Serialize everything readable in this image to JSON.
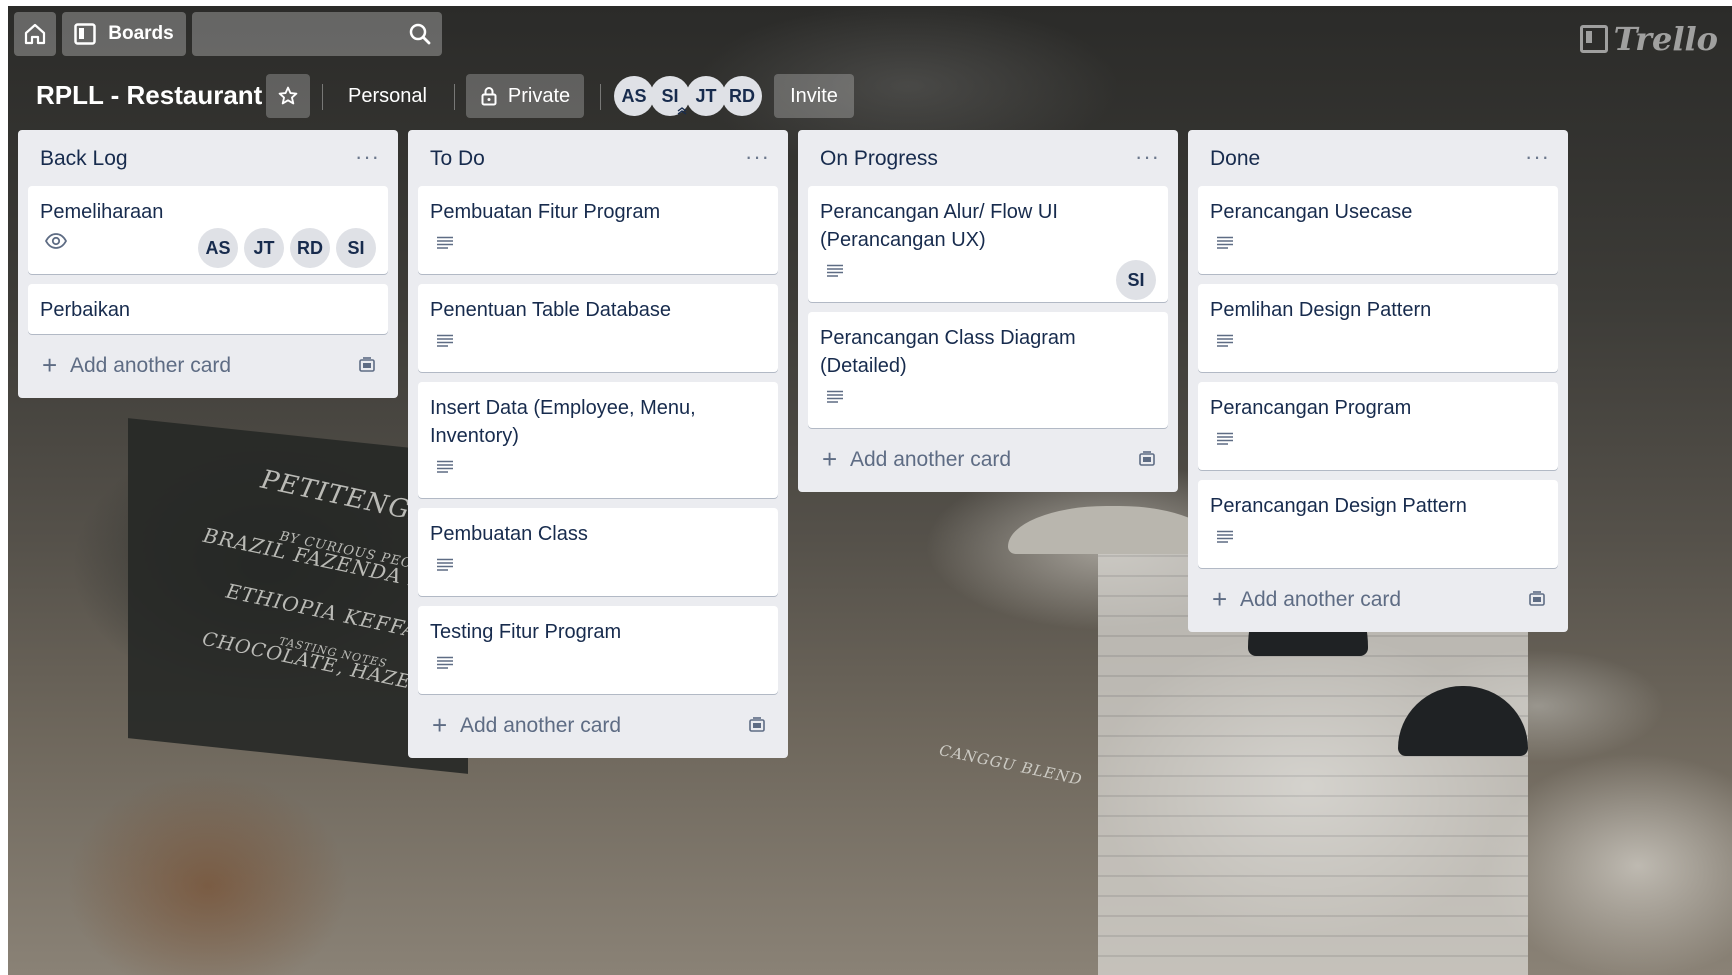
{
  "topbar": {
    "boards_label": "Boards",
    "logo_text": "Trello"
  },
  "board": {
    "title": "RPLL - Restaurant",
    "visibility_team": "Personal",
    "privacy": "Private",
    "members": [
      "AS",
      "SI",
      "JT",
      "RD"
    ],
    "invite_label": "Invite"
  },
  "lists": [
    {
      "title": "Back Log",
      "cards": [
        {
          "title": "Pemeliharaan",
          "watch": true,
          "members": [
            "AS",
            "JT",
            "RD",
            "SI"
          ]
        },
        {
          "title": "Perbaikan"
        }
      ],
      "add_label": "Add another card"
    },
    {
      "title": "To Do",
      "cards": [
        {
          "title": "Pembuatan Fitur Program",
          "description": true
        },
        {
          "title": "Penentuan Table Database",
          "description": true
        },
        {
          "title": "Insert Data (Employee, Menu, Inventory)",
          "description": true
        },
        {
          "title": "Pembuatan Class",
          "description": true
        },
        {
          "title": "Testing Fitur Program",
          "description": true
        }
      ],
      "add_label": "Add another card"
    },
    {
      "title": "On Progress",
      "cards": [
        {
          "title": "Perancangan Alur/ Flow UI (Perancangan UX)",
          "description": true,
          "members": [
            "SI"
          ]
        },
        {
          "title": "Perancangan Class Diagram (Detailed)",
          "description": true
        }
      ],
      "add_label": "Add another card"
    },
    {
      "title": "Done",
      "cards": [
        {
          "title": "Perancangan Usecase",
          "description": true
        },
        {
          "title": "Pemlihan Design Pattern",
          "description": true
        },
        {
          "title": "Perancangan Program",
          "description": true
        },
        {
          "title": "Perancangan Design Pattern",
          "description": true
        }
      ],
      "add_label": "Add another card"
    }
  ],
  "background_text": {
    "chalk_line_1": "PETITENGET BLEND",
    "chalk_line_2": "BY CURIOUS PEOPLE",
    "chalk_line_3": "BRAZIL FAZENDA FUTRA SULAWESI TORAJA",
    "chalk_line_4": "ETHIOPIA KEFFA NATURAL",
    "chalk_line_5": "TASTING NOTES",
    "chalk_line_6": "CHOCOLATE, HAZELNUT, TANGERINE",
    "sign_text": "CANGGU BLEND"
  },
  "colors": {
    "list_bg": "#ebecf0",
    "card_bg": "#ffffff",
    "text": "#172b4d",
    "muted": "#5e6c84"
  }
}
